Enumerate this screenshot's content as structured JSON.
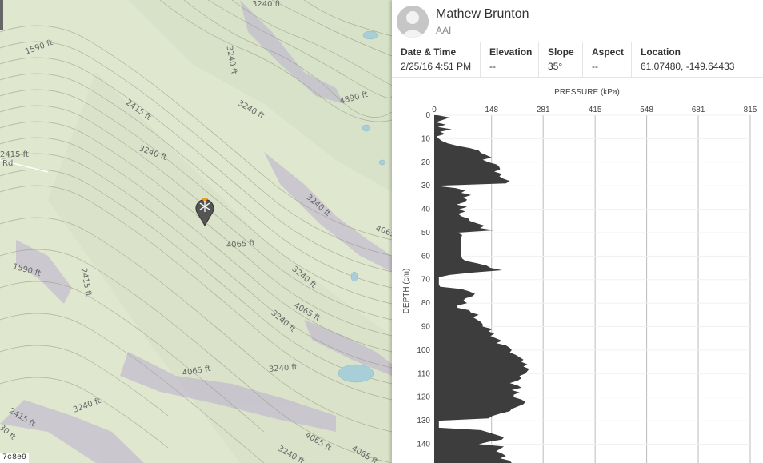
{
  "map": {
    "contour_labels": [
      "1590 ft",
      "2415 ft",
      "3240 ft",
      "3240 ft",
      "3240 ft",
      "4890 ft",
      "3240 ft",
      "4065 ft",
      "3240 ft",
      "1590 ft",
      "2415 ft",
      "3240 ft",
      "4065 ft",
      "3240 ft",
      "3240 ft",
      "4065 ft",
      "2415 ft",
      "3240 ft",
      "4065 ft",
      "4065 ft",
      "3240 ft",
      "2415 ft",
      "4065 ft",
      "Rd",
      "30 ft"
    ],
    "marker_icon": "snowflake-marker-icon",
    "map_id": "7c8e9",
    "colors": {
      "terrain": "#dfe7cf",
      "contour": "#9aa08a",
      "steep": "#b9a9c9",
      "water": "#a8cfd8"
    }
  },
  "observation": {
    "user_name": "Mathew Brunton",
    "user_org": "AAI",
    "avatar_icon": "user-avatar-icon",
    "fields": [
      {
        "label": "Date & Time",
        "value": "2/25/16 4:51 PM"
      },
      {
        "label": "Elevation",
        "value": "--"
      },
      {
        "label": "Slope",
        "value": "35°"
      },
      {
        "label": "Aspect",
        "value": "--"
      },
      {
        "label": "Location",
        "value": "61.07480, -149.64433"
      }
    ]
  },
  "chart_data": {
    "type": "area",
    "title": "PRESSURE (kPa)",
    "ylabel": "DEPTH (cm)",
    "x_ticks": [
      "0",
      "148",
      "281",
      "415",
      "548",
      "681",
      "815"
    ],
    "x_tick_values": [
      0,
      148,
      281,
      415,
      548,
      681,
      815
    ],
    "y_ticks": [
      "0",
      "10",
      "20",
      "30",
      "40",
      "50",
      "60",
      "70",
      "80",
      "90",
      "100",
      "110",
      "120",
      "130",
      "140"
    ],
    "xlim": [
      0,
      815
    ],
    "ylim": [
      0,
      148
    ],
    "depth": [
      0,
      1,
      2,
      3,
      4,
      5,
      6,
      7,
      8,
      9,
      10,
      11,
      12,
      13,
      14,
      15,
      16,
      17,
      18,
      19,
      20,
      21,
      22,
      23,
      24,
      25,
      26,
      27,
      28,
      29,
      30,
      31,
      32,
      33,
      34,
      35,
      36,
      37,
      38,
      39,
      40,
      41,
      42,
      43,
      44,
      45,
      46,
      47,
      48,
      49,
      50,
      51,
      52,
      53,
      54,
      55,
      56,
      57,
      58,
      59,
      60,
      61,
      62,
      63,
      64,
      65,
      66,
      67,
      68,
      69,
      70,
      71,
      72,
      73,
      74,
      75,
      76,
      77,
      78,
      79,
      80,
      81,
      82,
      83,
      84,
      85,
      86,
      87,
      88,
      89,
      90,
      91,
      92,
      93,
      94,
      95,
      96,
      97,
      98,
      99,
      100,
      101,
      102,
      103,
      104,
      105,
      106,
      107,
      108,
      109,
      110,
      111,
      112,
      113,
      114,
      115,
      116,
      117,
      118,
      119,
      120,
      121,
      122,
      123,
      124,
      125,
      126,
      127,
      128,
      129,
      130,
      131,
      132,
      133,
      134,
      135,
      136,
      137,
      138,
      139,
      140,
      141,
      142,
      143,
      144,
      145,
      146,
      147,
      148
    ],
    "pressure": [
      8,
      40,
      22,
      4,
      30,
      10,
      45,
      15,
      28,
      6,
      12,
      20,
      35,
      60,
      92,
      115,
      120,
      135,
      148,
      125,
      140,
      162,
      168,
      170,
      155,
      175,
      168,
      178,
      195,
      185,
      4,
      55,
      80,
      70,
      95,
      75,
      85,
      78,
      58,
      85,
      65,
      80,
      62,
      70,
      88,
      92,
      110,
      130,
      118,
      155,
      60,
      72,
      70,
      70,
      70,
      70,
      70,
      70,
      70,
      70,
      70,
      72,
      80,
      110,
      135,
      145,
      175,
      100,
      40,
      12,
      12,
      12,
      12,
      15,
      70,
      90,
      105,
      100,
      80,
      75,
      85,
      60,
      60,
      90,
      95,
      115,
      100,
      110,
      120,
      125,
      125,
      150,
      140,
      155,
      145,
      160,
      175,
      160,
      185,
      195,
      200,
      195,
      210,
      220,
      230,
      225,
      240,
      230,
      245,
      240,
      235,
      220,
      225,
      215,
      195,
      215,
      225,
      200,
      220,
      205,
      205,
      225,
      235,
      230,
      215,
      200,
      195,
      170,
      150,
      140,
      12,
      12,
      12,
      12,
      120,
      140,
      160,
      180,
      175,
      140,
      115,
      180,
      170,
      160,
      175,
      185,
      170,
      195,
      200
    ]
  }
}
